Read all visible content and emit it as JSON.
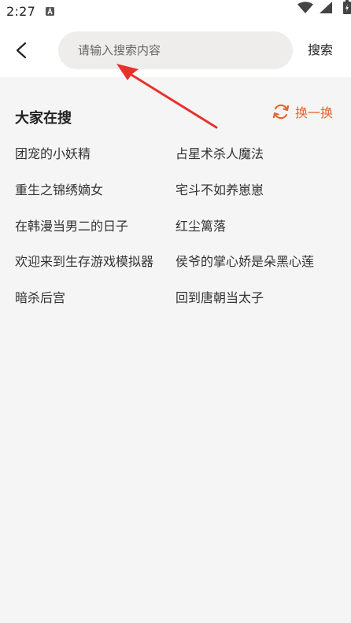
{
  "status_bar": {
    "time": "2:27",
    "icons": [
      "notification-a-icon",
      "wifi-icon",
      "signal-icon",
      "battery-icon"
    ]
  },
  "header": {
    "back_icon": "chevron-left-icon",
    "search_placeholder": "请输入搜索内容",
    "search_value": "",
    "search_button_label": "搜索"
  },
  "hot_searches": {
    "title": "大家在搜",
    "refresh_label": "换一换",
    "refresh_icon": "refresh-icon",
    "accent_color": "#e8632a",
    "items": [
      "团宠的小妖精",
      "占星术杀人魔法",
      "重生之锦绣嫡女",
      "宅斗不如养崽崽",
      "在韩漫当男二的日子",
      "红尘篱落",
      "欢迎来到生存游戏模拟器",
      "侯爷的掌心娇是朵黑心莲",
      "暗杀后宫",
      "回到唐朝当太子"
    ]
  },
  "annotation": {
    "type": "red-arrow",
    "color": "#e8312a"
  }
}
